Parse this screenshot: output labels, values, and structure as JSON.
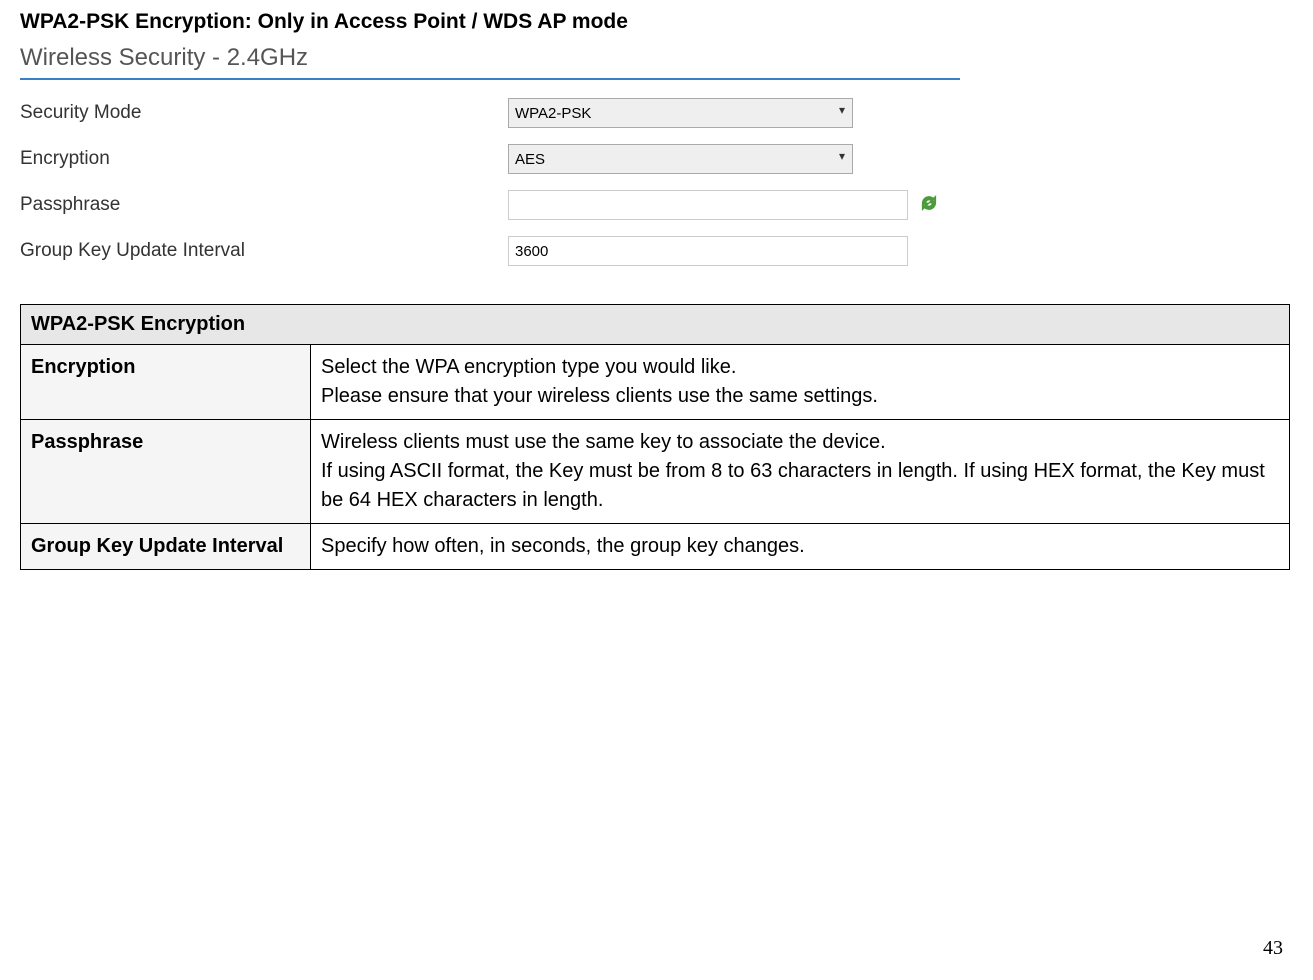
{
  "heading": "WPA2-PSK Encryption: Only in Access Point / WDS AP mode",
  "panel": {
    "title": "Wireless Security - 2.4GHz",
    "rows": {
      "security_mode_label": "Security Mode",
      "security_mode_value": "WPA2-PSK",
      "encryption_label": "Encryption",
      "encryption_value": "AES",
      "passphrase_label": "Passphrase",
      "passphrase_value": "",
      "interval_label": "Group Key Update Interval",
      "interval_value": "3600"
    }
  },
  "table": {
    "header": "WPA2-PSK Encryption",
    "rows": [
      {
        "label": "Encryption",
        "desc_line1": "Select the WPA encryption type you would like.",
        "desc_line2": "Please ensure that your wireless clients use the same settings."
      },
      {
        "label": "Passphrase",
        "desc_line1": "Wireless clients must use the same key to associate the device.",
        "desc_line2": "If using ASCII format, the Key must be from 8 to 63 characters in length. If using HEX format, the Key must be 64 HEX characters in length."
      },
      {
        "label": "Group Key Update Interval",
        "desc_line1": "Specify how often, in seconds, the group key changes.",
        "desc_line2": ""
      }
    ]
  },
  "page_number": "43"
}
